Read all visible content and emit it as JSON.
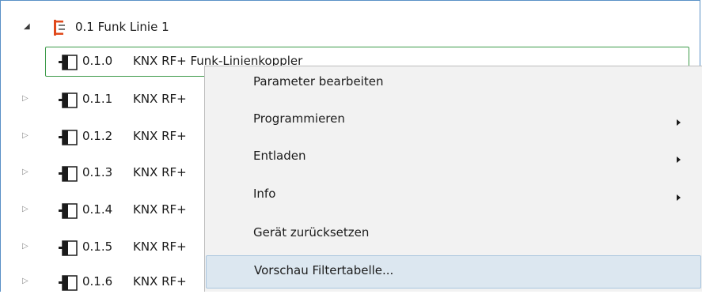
{
  "tree": {
    "line": {
      "expander": "◢",
      "label": "0.1 Funk Linie 1"
    },
    "devices": [
      {
        "number": "0.1.0",
        "name": "KNX RF+ Funk-Linienkoppler",
        "expander": ""
      },
      {
        "number": "0.1.1",
        "name": "KNX RF+",
        "expander": "▷"
      },
      {
        "number": "0.1.2",
        "name": "KNX RF+",
        "expander": "▷"
      },
      {
        "number": "0.1.3",
        "name": "KNX RF+",
        "expander": "▷"
      },
      {
        "number": "0.1.4",
        "name": "KNX RF+",
        "expander": "▷"
      },
      {
        "number": "0.1.5",
        "name": "KNX RF+",
        "expander": "▷"
      },
      {
        "number": "0.1.6",
        "name": "KNX RF+",
        "expander": "▷"
      }
    ]
  },
  "context_menu": {
    "items": [
      {
        "label": "Parameter bearbeiten",
        "has_submenu": false
      },
      {
        "label": "Programmieren",
        "has_submenu": true
      },
      {
        "label": "Entladen",
        "has_submenu": true
      },
      {
        "label": "Info",
        "has_submenu": true
      },
      {
        "label": "Gerät zurücksetzen",
        "has_submenu": false
      },
      {
        "label": "Vorschau Filtertabelle...",
        "has_submenu": false,
        "highlighted": true
      }
    ]
  },
  "colors": {
    "line_icon": "#e0491b",
    "selection_border": "#3c9a49",
    "menu_background": "#f2f2f2",
    "menu_highlight": "#dce7f0",
    "window_border": "#5a91c6"
  }
}
